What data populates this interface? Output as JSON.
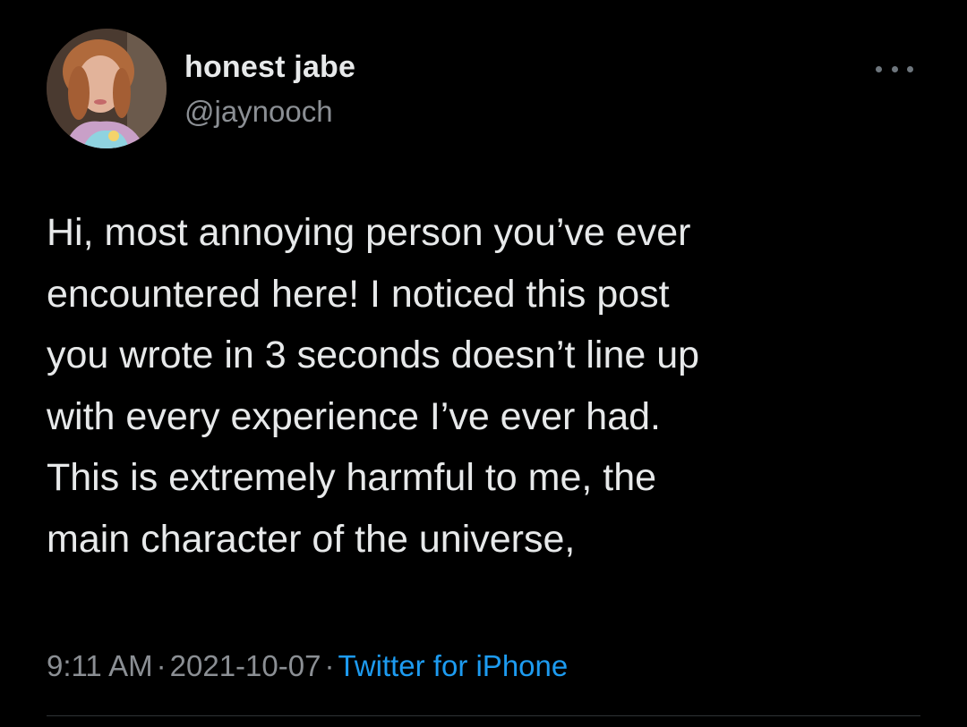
{
  "colors": {
    "background": "#000000",
    "text_primary": "#e7e9ea",
    "text_secondary": "#8b8f94",
    "link": "#1d9bf0",
    "divider": "#2f3336"
  },
  "author": {
    "display_name": "honest jabe",
    "handle": "@jaynooch",
    "avatar_icon": "profile-photo"
  },
  "menu": {
    "icon": "more-horizontal-icon"
  },
  "tweet": {
    "text": "Hi, most annoying person you’ve ever\nencountered here! I noticed this post\nyou wrote in 3 seconds doesn’t line up\nwith every experience I’ve ever had.\nThis is extremely harmful to me, the\nmain character of the universe,"
  },
  "meta": {
    "time": "9:11 AM",
    "date": "2021-10-07",
    "separator": "·",
    "source": "Twitter for iPhone"
  }
}
